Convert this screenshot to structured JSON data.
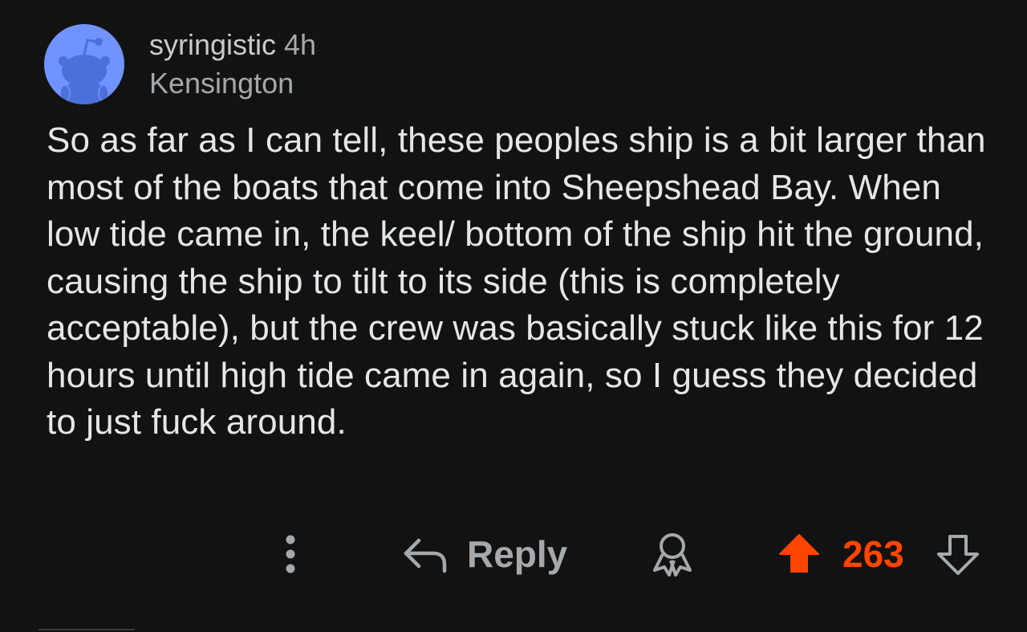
{
  "comment": {
    "username": "syringistic",
    "timestamp": "4h",
    "flair": "Kensington",
    "body": "So as far as I can tell, these peoples ship is a bit larger than most of the boats that come into Sheepshead Bay. When low tide came in, the keel/ bottom of the ship hit the ground, causing the ship to tilt to its side (this is completely acceptable), but the crew was basically stuck like this for 12 hours until high tide came in again, so I guess they decided to just fuck around."
  },
  "actions": {
    "more_icon": "vertical-dots-icon",
    "reply_icon": "reply-arrow-icon",
    "reply_label": "Reply",
    "award_icon": "award-ribbon-icon",
    "upvote_icon": "upvote-arrow-icon",
    "upvote_active": true,
    "score": "263",
    "downvote_icon": "downvote-arrow-icon"
  },
  "colors": {
    "background": "#121212",
    "text_primary": "#e4e6e8",
    "text_secondary": "#a5a9ab",
    "upvote": "#ff4500",
    "avatar_bg": "#7193ff"
  }
}
